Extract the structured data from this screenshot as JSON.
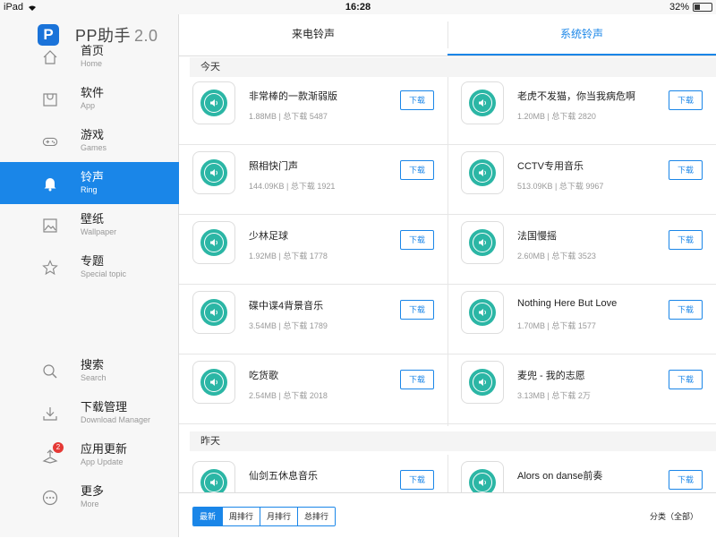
{
  "status": {
    "device": "iPad",
    "time": "16:28",
    "battery": "32%",
    "battery_level": 0.32
  },
  "brand": {
    "logo_letter": "P",
    "name": "PP助手",
    "version": "2.0"
  },
  "nav": [
    {
      "zh": "首页",
      "en": "Home",
      "icon": "home-icon"
    },
    {
      "zh": "软件",
      "en": "App",
      "icon": "app-bag-icon"
    },
    {
      "zh": "游戏",
      "en": "Games",
      "icon": "gamepad-icon"
    },
    {
      "zh": "铃声",
      "en": "Ring",
      "icon": "bell-icon",
      "active": true
    },
    {
      "zh": "壁纸",
      "en": "Wallpaper",
      "icon": "picture-icon"
    },
    {
      "zh": "专题",
      "en": "Special topic",
      "icon": "star-icon"
    },
    {
      "zh": "搜索",
      "en": "Search",
      "icon": "search-icon"
    },
    {
      "zh": "下载管理",
      "en": "Download Manager",
      "icon": "download-icon"
    },
    {
      "zh": "应用更新",
      "en": "App Update",
      "icon": "update-icon",
      "badge": "2"
    },
    {
      "zh": "更多",
      "en": "More",
      "icon": "more-icon"
    }
  ],
  "tabs": {
    "incoming": "来电铃声",
    "system": "系统铃声"
  },
  "sections": {
    "today": "今天",
    "yesterday": "昨天"
  },
  "download_label": "下载",
  "ringtones_today": [
    {
      "title": "非常棒的一款渐弱版",
      "size": "1.88MB",
      "downloads": "5487"
    },
    {
      "title": "老虎不发猫，你当我病危啊",
      "size": "1.20MB",
      "downloads": "2820"
    },
    {
      "title": "照相快门声",
      "size": "144.09KB",
      "downloads": "1921"
    },
    {
      "title": "CCTV专用音乐",
      "size": "513.09KB",
      "downloads": "9967"
    },
    {
      "title": "少林足球",
      "size": "1.92MB",
      "downloads": "1778"
    },
    {
      "title": "法国慢摇",
      "size": "2.60MB",
      "downloads": "3523"
    },
    {
      "title": "碟中谍4背景音乐",
      "size": "3.54MB",
      "downloads": "1789"
    },
    {
      "title": "Nothing Here But Love",
      "size": "1.70MB",
      "downloads": "1577"
    },
    {
      "title": "吃货歌",
      "size": "2.54MB",
      "downloads": "2018"
    },
    {
      "title": "麦兜 - 我的志愿",
      "size": "3.13MB",
      "downloads": "2万"
    }
  ],
  "ringtones_yesterday": [
    {
      "title": "仙剑五休息音乐"
    },
    {
      "title": "Alors on danse前奏"
    }
  ],
  "meta_sep": " | 总下载 ",
  "bottom": {
    "filters": [
      "最新",
      "周排行",
      "月排行",
      "总排行"
    ],
    "active_filter": 0,
    "category": "分类（全部）"
  }
}
